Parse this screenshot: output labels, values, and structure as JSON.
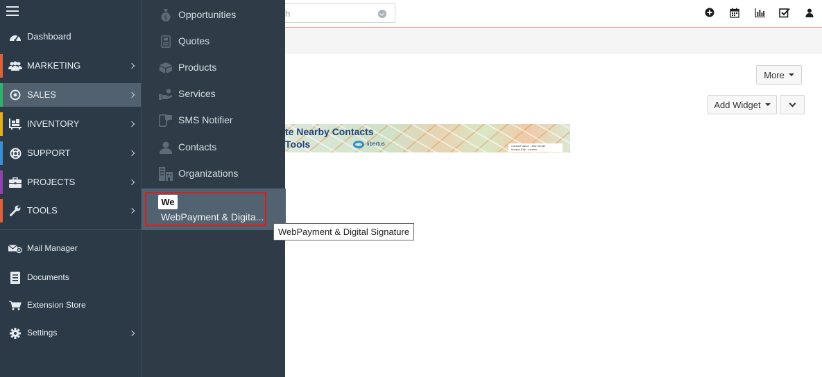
{
  "search": {
    "placeholder": "h"
  },
  "header": {
    "icons": [
      "add-icon",
      "calendar-icon",
      "chart-icon",
      "tasks-icon",
      "user-icon"
    ]
  },
  "actions": {
    "more_label": "More",
    "add_widget_label": "Add Widget"
  },
  "banner": {
    "line1": "te Nearby Contacts",
    "line2": "Tools",
    "brand": "libertus",
    "card_line1": "Contact Name : John Smith",
    "card_line2": "Invoice City : London"
  },
  "sidebar": {
    "items": [
      {
        "label": "Dashboard"
      },
      {
        "label": "MARKETING",
        "stripe": "#e0623b"
      },
      {
        "label": "SALES",
        "stripe": "#2fb36b"
      },
      {
        "label": "INVENTORY",
        "stripe": "#e2b01e"
      },
      {
        "label": "SUPPORT",
        "stripe": "#3b8fd6"
      },
      {
        "label": "PROJECTS",
        "stripe": "#8e44ad"
      },
      {
        "label": "TOOLS",
        "stripe": "#e0623b"
      }
    ],
    "lower_items": [
      {
        "label": "Mail Manager"
      },
      {
        "label": "Documents"
      },
      {
        "label": "Extension Store"
      },
      {
        "label": "Settings"
      }
    ]
  },
  "submenu": {
    "items": [
      {
        "label": "Opportunities"
      },
      {
        "label": "Quotes"
      },
      {
        "label": "Products"
      },
      {
        "label": "Services"
      },
      {
        "label": "SMS Notifier"
      },
      {
        "label": "Contacts"
      },
      {
        "label": "Organizations"
      }
    ],
    "active": {
      "badge": "We",
      "label": "WebPayment & Digita..."
    }
  },
  "tooltip": {
    "text": "WebPayment & Digital Signature"
  }
}
